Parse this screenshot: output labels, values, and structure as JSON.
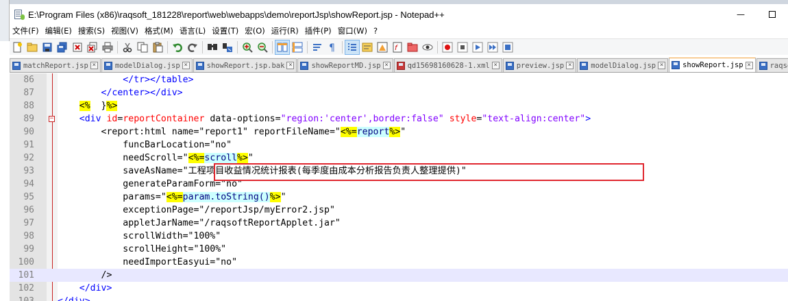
{
  "window": {
    "title": "E:\\Program Files (x86)\\raqsoft_181228\\report\\web\\webapps\\demo\\reportJsp\\showReport.jsp - Notepad++",
    "minimize_label": "—",
    "close_label": "✕"
  },
  "menu": [
    "文件(F)",
    "编辑(E)",
    "搜索(S)",
    "视图(V)",
    "格式(M)",
    "语言(L)",
    "设置(T)",
    "宏(O)",
    "运行(R)",
    "插件(P)",
    "窗口(W)",
    "?"
  ],
  "toolbar": [
    "new-file-icon",
    "open-file-icon",
    "save-icon",
    "save-all-icon",
    "close-icon",
    "close-all-icon",
    "print-icon",
    "sep",
    "cut-icon",
    "copy-icon",
    "paste-icon",
    "sep",
    "undo-icon",
    "redo-icon",
    "sep",
    "find-icon",
    "replace-icon",
    "sep",
    "zoom-in-icon",
    "zoom-out-icon",
    "sep",
    "sync-vertical-icon",
    "sync-horizontal-icon",
    "sep",
    "word-wrap-icon",
    "show-all-chars-icon",
    "sep",
    "indent-guide-icon",
    "user-language-icon",
    "document-map-icon",
    "function-list-icon",
    "folder-workspace-icon",
    "monitor-icon",
    "sep",
    "record-macro-icon",
    "stop-record-icon",
    "play-macro-icon",
    "run-macro-multiple-icon",
    "save-macro-icon"
  ],
  "tabs": [
    {
      "label": "matchReport.jsp",
      "modified": false,
      "active": false
    },
    {
      "label": "modelDialog.jsp",
      "modified": false,
      "active": false
    },
    {
      "label": "showReport.jsp.bak",
      "modified": false,
      "active": false
    },
    {
      "label": "showReportMD.jsp",
      "modified": false,
      "active": false
    },
    {
      "label": "qd15698160628-1.xml",
      "modified": true,
      "active": false
    },
    {
      "label": "preview.jsp",
      "modified": false,
      "active": false
    },
    {
      "label": "modelDialog.jsp",
      "modified": false,
      "active": false
    },
    {
      "label": "showReport.jsp",
      "modified": false,
      "active": true
    },
    {
      "label": "raqsoftConfig.xml",
      "modified": false,
      "active": false
    }
  ],
  "editor": {
    "current_line": "101",
    "lines": [
      {
        "num": "86",
        "fold": "",
        "tokens": [
          [
            "txt",
            "            "
          ],
          [
            "tag",
            "</tr></table>"
          ]
        ]
      },
      {
        "num": "87",
        "fold": "",
        "tokens": [
          [
            "txt",
            "        "
          ],
          [
            "tag",
            "</center></div>"
          ]
        ]
      },
      {
        "num": "88",
        "fold": "",
        "tokens": [
          [
            "txt",
            "    "
          ],
          [
            "jsp",
            "<%"
          ],
          [
            "txt",
            "  }"
          ],
          [
            "jsp",
            "%>"
          ]
        ]
      },
      {
        "num": "89",
        "fold": "⊟",
        "tokens": [
          [
            "txt",
            "    "
          ],
          [
            "tag",
            "<div "
          ],
          [
            "attr",
            "id"
          ],
          [
            "txt",
            "="
          ],
          [
            "attr",
            "reportContainer"
          ],
          [
            "txt",
            " data-options="
          ],
          [
            "val",
            "\"region:'center',border:false\""
          ],
          [
            "txt",
            " "
          ],
          [
            "attr",
            "style"
          ],
          [
            "txt",
            "="
          ],
          [
            "val",
            "\"text-align:center\""
          ],
          [
            "tag",
            ">"
          ]
        ]
      },
      {
        "num": "90",
        "fold": "",
        "tokens": [
          [
            "txt",
            "        <report:html name=\"report1\" reportFileName=\""
          ],
          [
            "jsp",
            "<%="
          ],
          [
            "expr",
            "report"
          ],
          [
            "jsp",
            "%>"
          ],
          [
            "txt",
            "\""
          ]
        ]
      },
      {
        "num": "91",
        "fold": "",
        "tokens": [
          [
            "txt",
            "            funcBarLocation=\"no\""
          ]
        ]
      },
      {
        "num": "92",
        "fold": "",
        "tokens": [
          [
            "txt",
            "            needScroll=\""
          ],
          [
            "jsp",
            "<%="
          ],
          [
            "expr",
            "scroll"
          ],
          [
            "jsp",
            "%>"
          ],
          [
            "txt",
            "\""
          ]
        ]
      },
      {
        "num": "93",
        "fold": "",
        "tokens": [
          [
            "txt",
            "            saveAsName=\"工程项目收益情况统计报表(每季度由成本分析报告负责人整理提供)\""
          ]
        ]
      },
      {
        "num": "94",
        "fold": "",
        "tokens": [
          [
            "txt",
            "            generateParamForm=\"no\""
          ]
        ]
      },
      {
        "num": "95",
        "fold": "",
        "tokens": [
          [
            "txt",
            "            params=\""
          ],
          [
            "jsp",
            "<%="
          ],
          [
            "expr",
            "param.toString()"
          ],
          [
            "jsp",
            "%>"
          ],
          [
            "txt",
            "\""
          ]
        ]
      },
      {
        "num": "96",
        "fold": "",
        "tokens": [
          [
            "txt",
            "            exceptionPage=\"/reportJsp/myError2.jsp\""
          ]
        ]
      },
      {
        "num": "97",
        "fold": "",
        "tokens": [
          [
            "txt",
            "            appletJarName=\"/raqsoftReportApplet.jar\""
          ]
        ]
      },
      {
        "num": "98",
        "fold": "",
        "tokens": [
          [
            "txt",
            "            scrollWidth=\"100%\""
          ]
        ]
      },
      {
        "num": "99",
        "fold": "",
        "tokens": [
          [
            "txt",
            "            scrollHeight=\"100%\""
          ]
        ]
      },
      {
        "num": "100",
        "fold": "",
        "tokens": [
          [
            "txt",
            "            needImportEasyui=\"no\""
          ]
        ]
      },
      {
        "num": "101",
        "fold": "",
        "tokens": [
          [
            "txt",
            "        />"
          ]
        ]
      },
      {
        "num": "102",
        "fold": "",
        "tokens": [
          [
            "txt",
            "    "
          ],
          [
            "tag",
            "</div>"
          ]
        ]
      },
      {
        "num": "103",
        "fold": "",
        "tokens": [
          [
            "tag",
            "</div>"
          ]
        ]
      }
    ]
  },
  "colors": {
    "tag": "#0000ff",
    "attr": "#ff0000",
    "value": "#8000ff",
    "jsp_delim_bg": "#ffff00",
    "jsp_expr_bg": "#ccffff",
    "current_line_bg": "#e8e8ff",
    "annotation_box": "#e0262e",
    "active_tab_accent": "#f2a036"
  }
}
